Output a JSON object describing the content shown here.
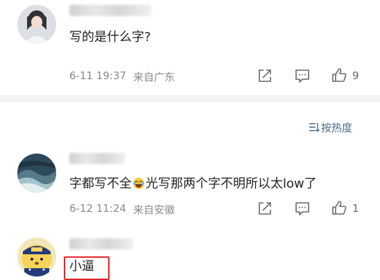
{
  "comments": [
    {
      "text": "写的是什么字?",
      "date": "6-11 19:37",
      "location": "来自广东",
      "like_count": "9"
    },
    {
      "text_before": "字都写不全",
      "text_after": "光写那两个字不明所以太low了",
      "date": "6-12 11:24",
      "location": "来自安徽",
      "like_count": "1"
    },
    {
      "text": "小逼"
    }
  ],
  "sort": {
    "label": "按热度"
  },
  "icons": [
    "share-icon",
    "comment-icon",
    "like-icon",
    "sort-icon",
    "laughing-emoji-icon"
  ],
  "colors": {
    "highlight_box": "#e0262b",
    "sort_label": "#4a6a8a",
    "separator": "#f2f2f2"
  }
}
